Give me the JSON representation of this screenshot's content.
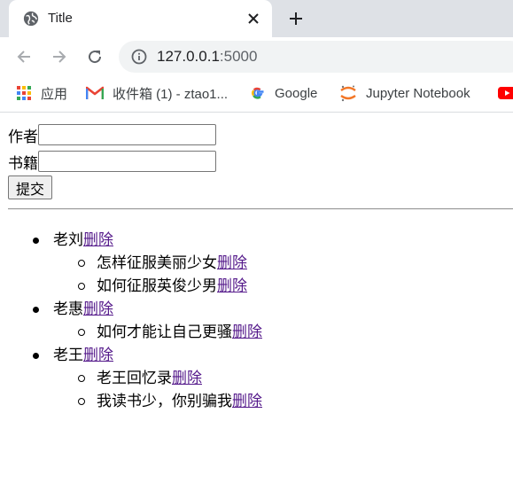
{
  "browser": {
    "tab_title": "Title",
    "url_host": "127.0.0.1",
    "url_port": ":5000",
    "bookmarks": [
      {
        "label": "应用",
        "icon": "apps-grid-icon"
      },
      {
        "label": "收件箱 (1) - ztao1...",
        "icon": "gmail-icon"
      },
      {
        "label": "Google",
        "icon": "google-icon"
      },
      {
        "label": "Jupyter Notebook",
        "icon": "jupyter-icon"
      },
      {
        "label": "",
        "icon": "youtube-icon"
      }
    ]
  },
  "form": {
    "author_label": "作者",
    "author_value": "",
    "book_label": "书籍",
    "book_value": "",
    "submit_label": "提交"
  },
  "delete_label": "删除",
  "authors": [
    {
      "name": "老刘",
      "books": [
        "怎样征服美丽少女",
        "如何征服英俊少男"
      ]
    },
    {
      "name": "老惠",
      "books": [
        "如何才能让自己更骚"
      ]
    },
    {
      "name": "老王",
      "books": [
        "老王回忆录",
        "我读书少，你别骗我"
      ]
    }
  ]
}
